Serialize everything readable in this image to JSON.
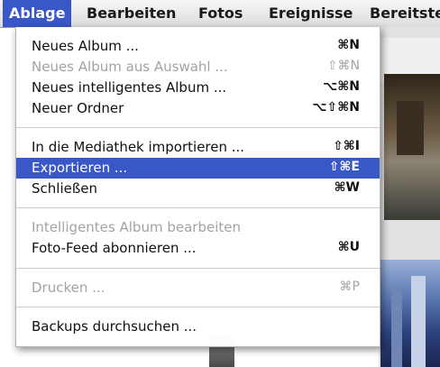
{
  "menubar": {
    "items": [
      {
        "label": "Ablage"
      },
      {
        "label": "Bearbeiten"
      },
      {
        "label": "Fotos"
      },
      {
        "label": "Ereignisse"
      },
      {
        "label": "Bereitste"
      }
    ],
    "active_index": 0
  },
  "menu": {
    "items": [
      {
        "label": "Neues Album ...",
        "shortcut": "⌘N",
        "enabled": true
      },
      {
        "label": "Neues Album aus Auswahl ...",
        "shortcut": "⇧⌘N",
        "enabled": false
      },
      {
        "label": "Neues intelligentes Album ...",
        "shortcut": "⌥⌘N",
        "enabled": true
      },
      {
        "label": "Neuer Ordner",
        "shortcut": "⌥⇧⌘N",
        "enabled": true
      },
      {
        "label": "In die Mediathek importieren ...",
        "shortcut": "⇧⌘I",
        "enabled": true
      },
      {
        "label": "Exportieren ...",
        "shortcut": "⇧⌘E",
        "enabled": true,
        "selected": true
      },
      {
        "label": "Schließen",
        "shortcut": "⌘W",
        "enabled": true
      },
      {
        "label": "Intelligentes Album bearbeiten",
        "shortcut": "",
        "enabled": false
      },
      {
        "label": "Foto-Feed abonnieren ...",
        "shortcut": "⌘U",
        "enabled": true
      },
      {
        "label": "Drucken ...",
        "shortcut": "⌘P",
        "enabled": false
      },
      {
        "label": "Backups durchsuchen ...",
        "shortcut": "",
        "enabled": true
      }
    ]
  }
}
